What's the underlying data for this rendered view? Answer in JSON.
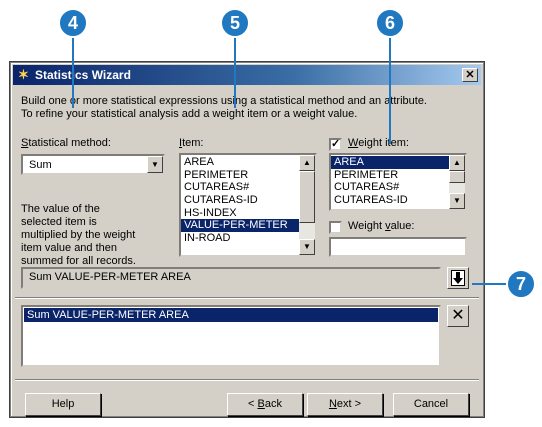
{
  "callouts": [
    "4",
    "5",
    "6",
    "7"
  ],
  "window": {
    "title": "Statistics Wizard",
    "close_glyph": "✕"
  },
  "instructions": [
    "Build one or more statistical expressions using a statistical method and an attribute.",
    "To refine your statistical analysis add a weight item or a weight value."
  ],
  "method": {
    "label_prefix": "S",
    "label_rest": "tatistical method:",
    "value": "Sum",
    "description": "The value of the selected item is multiplied by the weight item value and then summed for all records."
  },
  "item": {
    "label_prefix": "I",
    "label_rest": "tem:",
    "options": [
      "AREA",
      "PERIMETER",
      "CUTAREAS#",
      "CUTAREAS-ID",
      "HS-INDEX",
      "VALUE-PER-METER",
      "IN-ROAD"
    ],
    "selected_index": 5
  },
  "weight_item": {
    "checked": true,
    "label_prefix": "W",
    "label_rest": "eight item:",
    "options": [
      "AREA",
      "PERIMETER",
      "CUTAREAS#",
      "CUTAREAS-ID"
    ],
    "selected_index": 0
  },
  "weight_value": {
    "checked": false,
    "label_prefix": "Weight ",
    "label_under": "v",
    "label_rest": "alue:",
    "value": ""
  },
  "expression": {
    "current": "Sum VALUE-PER-METER AREA"
  },
  "expressions_list": [
    "Sum VALUE-PER-METER AREA"
  ],
  "buttons": {
    "help": "Help",
    "back_under": "B",
    "back_rest": "ack",
    "back_prefix": "< ",
    "next_under": "N",
    "next_rest": "ext >",
    "cancel": "Cancel"
  }
}
